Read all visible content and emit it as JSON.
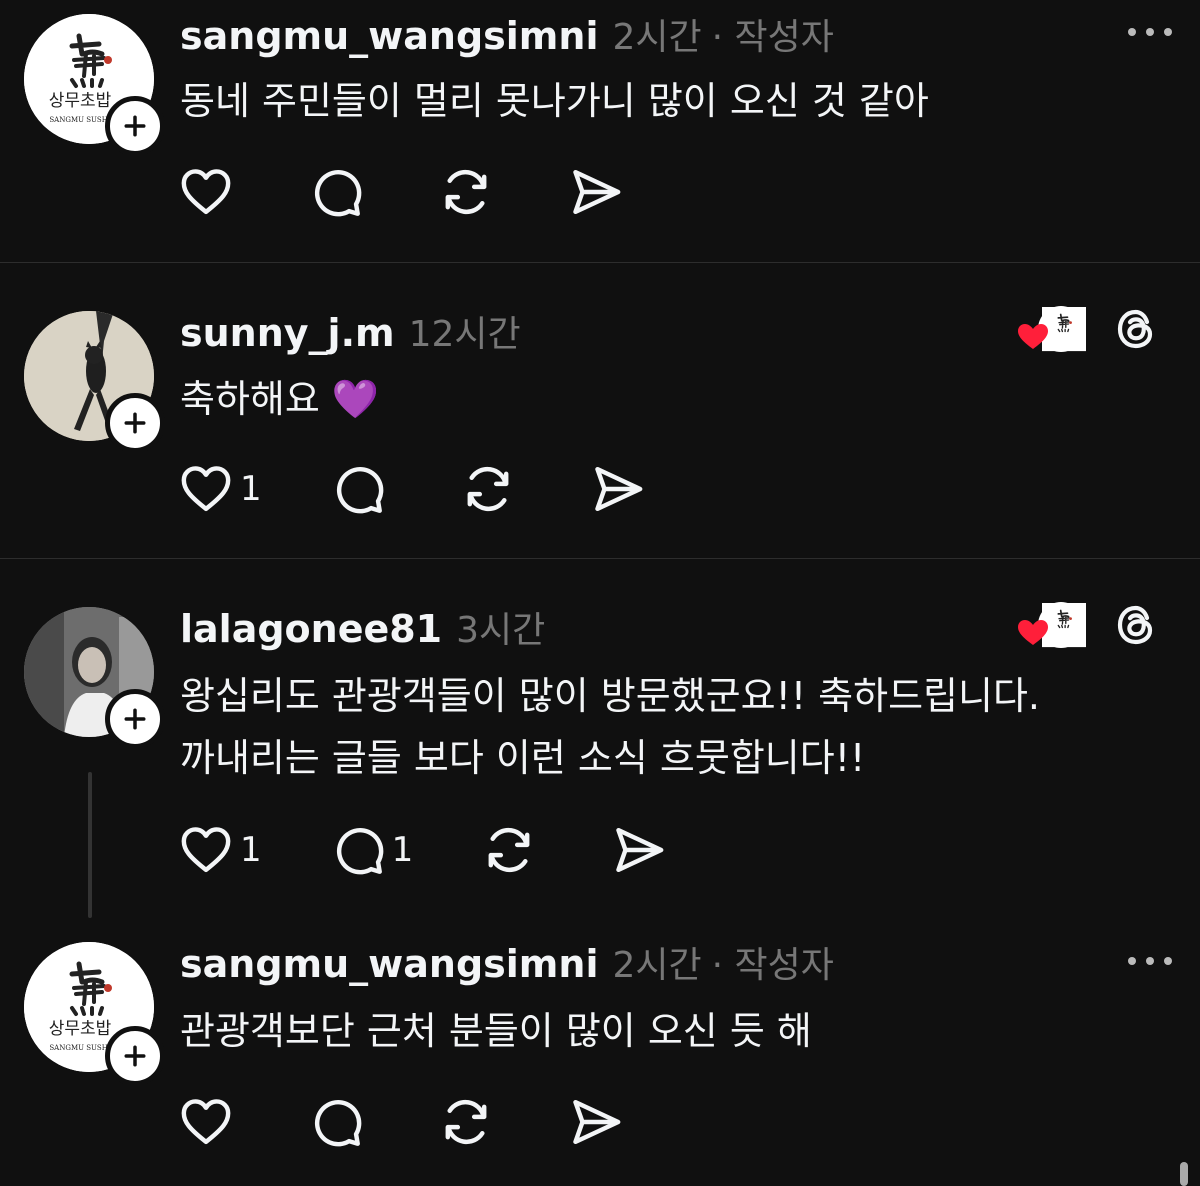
{
  "comments": [
    {
      "username": "sangmu_wangsimni",
      "time": "2시간",
      "author_tag": "· 작성자",
      "text_lines": [
        "동네 주민들이 멀리 못나가니 많이 오신 것 같아"
      ],
      "avatar": "sangmu-logo",
      "avatar_caption": "상무초밥",
      "avatar_caption_en": "SANGMU SUSHI",
      "like_count": "",
      "reply_count": ""
    },
    {
      "username": "sunny_j.m",
      "time": "12시간",
      "author_tag": "",
      "text_lines": [
        "축하해요 💜"
      ],
      "avatar": "cat-photo",
      "like_count": "1",
      "reply_count": ""
    },
    {
      "username": "lalagonee81",
      "time": "3시간",
      "author_tag": "",
      "text_lines": [
        "왕십리도 관광객들이 많이 방문했군요!! 축하드립니다.",
        "까내리는 글들 보다 이런 소식 흐뭇합니다!!"
      ],
      "avatar": "person-photo",
      "like_count": "1",
      "reply_count": "1"
    },
    {
      "username": "sangmu_wangsimni",
      "time": "2시간",
      "author_tag": "· 작성자",
      "text_lines": [
        "관광객보단 근처 분들이 많이 오신 듯 해"
      ],
      "avatar": "sangmu-logo",
      "avatar_caption": "상무초밥",
      "avatar_caption_en": "SANGMU SUSHI",
      "like_count": "",
      "reply_count": ""
    }
  ],
  "icons": {
    "like": "heart-icon",
    "reply": "comment-icon",
    "repost": "repost-icon",
    "share": "send-icon",
    "more": "more-icon",
    "app": "threads-icon",
    "follow": "plus-icon",
    "liked_by_author": "red-heart-icon"
  },
  "colors": {
    "background": "#101010",
    "text": "#f3f5f7",
    "muted": "#777777",
    "divider": "#2d2d2d",
    "heart": "#ff3040"
  }
}
